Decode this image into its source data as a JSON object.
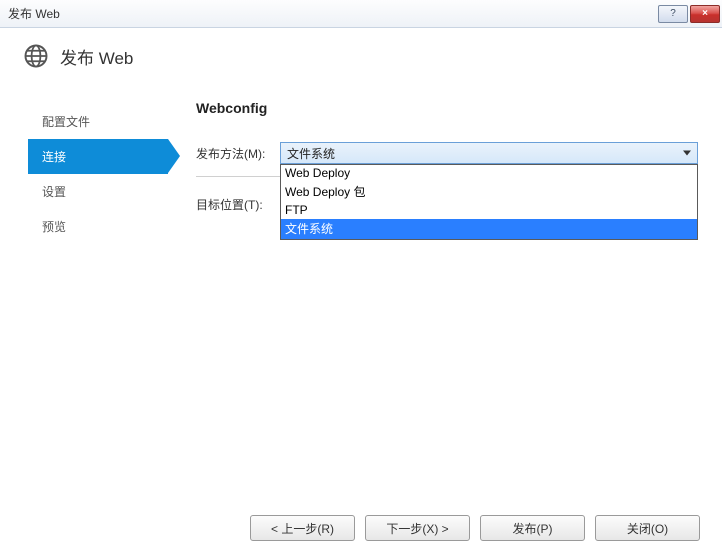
{
  "window": {
    "title": "发布 Web",
    "help_label": "?",
    "close_label": "×"
  },
  "header": {
    "title": "发布 Web"
  },
  "sidebar": {
    "items": [
      {
        "label": "配置文件"
      },
      {
        "label": "连接"
      },
      {
        "label": "设置"
      },
      {
        "label": "预览"
      }
    ],
    "active_index": 1
  },
  "main": {
    "section_title": "Webconfig",
    "publish_method": {
      "label": "发布方法(M):",
      "selected": "文件系统",
      "options": [
        "Web Deploy",
        "Web Deploy 包",
        "FTP",
        "文件系统"
      ],
      "highlighted_index": 3
    },
    "target_location": {
      "label": "目标位置(T):",
      "value": "",
      "browse_label": "..."
    }
  },
  "footer": {
    "prev": "< 上一步(R)",
    "next": "下一步(X) >",
    "publish": "发布(P)",
    "close": "关闭(O)"
  }
}
